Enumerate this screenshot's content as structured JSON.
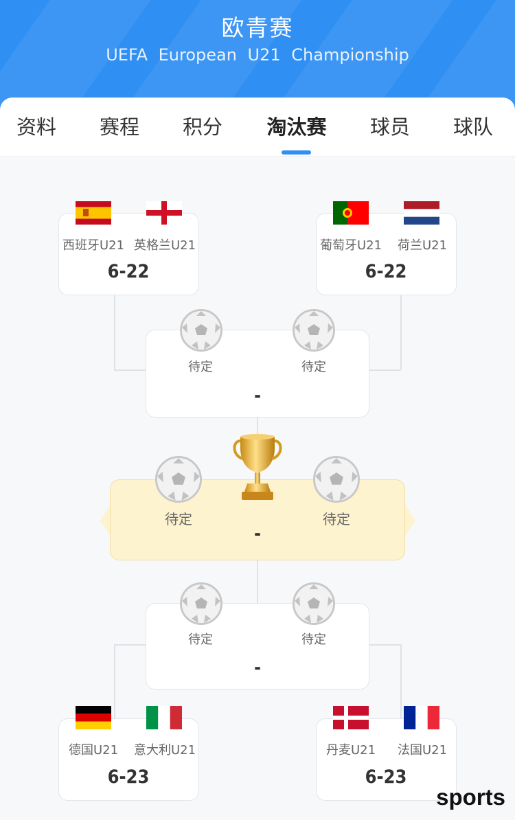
{
  "header": {
    "title": "欧青赛",
    "subtitle": "UEFA European U21 Championship"
  },
  "tabs": [
    {
      "label": "资料",
      "active": false
    },
    {
      "label": "赛程",
      "active": false
    },
    {
      "label": "积分",
      "active": false
    },
    {
      "label": "淘汰赛",
      "active": true
    },
    {
      "label": "球员",
      "active": false
    },
    {
      "label": "球队",
      "active": false
    }
  ],
  "bracket": {
    "semi_top_left": {
      "home": "西班牙U21",
      "away": "英格兰U21",
      "date": "6-22",
      "home_flag": "spain-flag",
      "away_flag": "england-flag"
    },
    "semi_top_right": {
      "home": "葡萄牙U21",
      "away": "荷兰U21",
      "date": "6-22",
      "home_flag": "portugal-flag",
      "away_flag": "netherlands-flag"
    },
    "semi_top": {
      "home": "待定",
      "away": "待定",
      "score": "-"
    },
    "final": {
      "home": "待定",
      "away": "待定",
      "score": "-",
      "icon": "trophy-icon"
    },
    "semi_bottom": {
      "home": "待定",
      "away": "待定",
      "score": "-"
    },
    "semi_bottom_left": {
      "home": "德国U21",
      "away": "意大利U21",
      "date": "6-23",
      "home_flag": "germany-flag",
      "away_flag": "italy-flag"
    },
    "semi_bottom_right": {
      "home": "丹麦U21",
      "away": "法国U21",
      "date": "6-23",
      "home_flag": "denmark-flag",
      "away_flag": "france-flag"
    }
  },
  "watermark": "sports",
  "colors": {
    "header": "#2f8ff3",
    "accent": "#2f8ff3",
    "final_bg": "#fdf3cf"
  }
}
